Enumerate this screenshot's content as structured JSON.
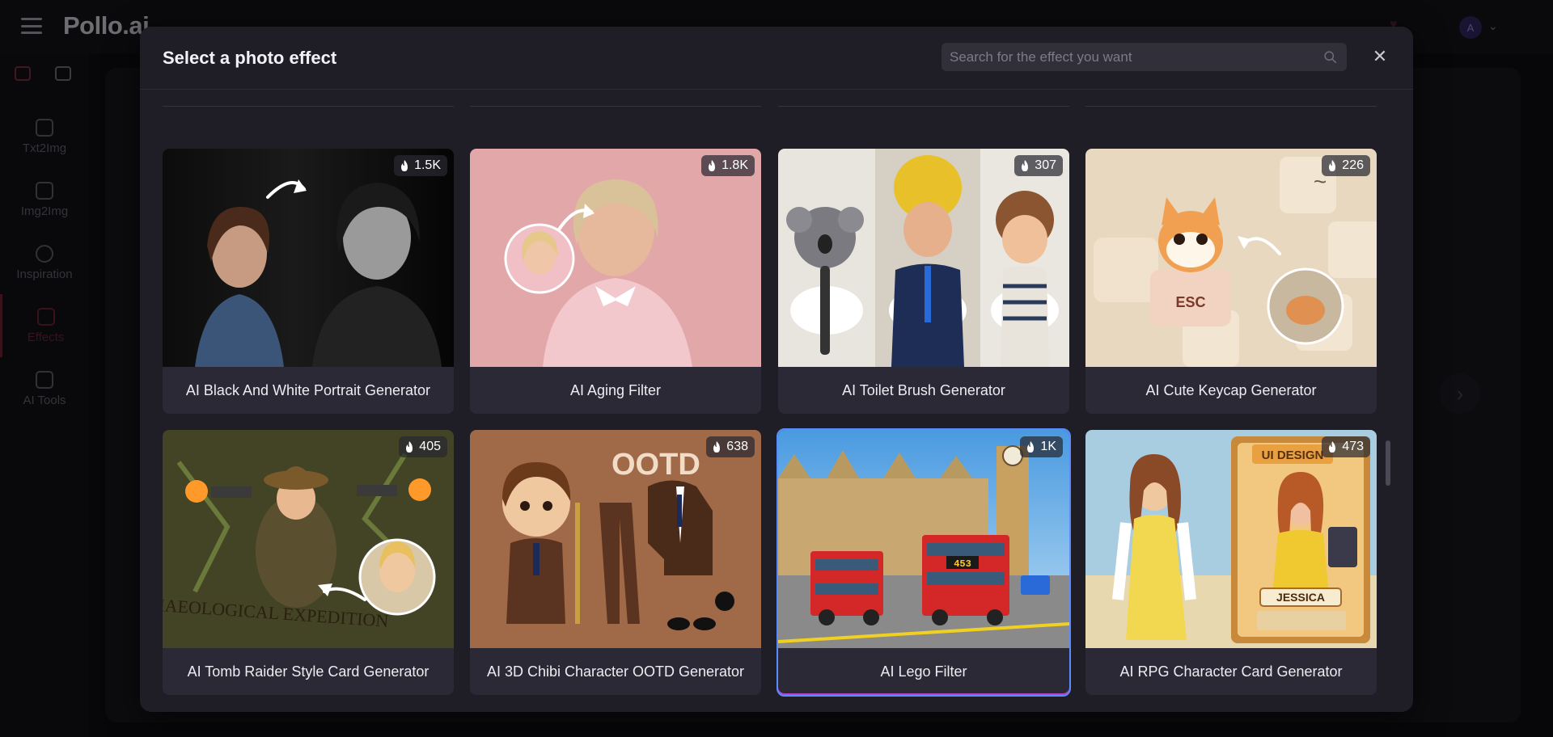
{
  "app": {
    "logo": "Pollo.ai",
    "avatar_initial": "A"
  },
  "sidebar": {
    "items": [
      {
        "label": "Txt2Img"
      },
      {
        "label": "Img2Img"
      },
      {
        "label": "Inspiration"
      },
      {
        "label": "Effects"
      },
      {
        "label": "AI Tools"
      }
    ]
  },
  "modal": {
    "title": "Select a photo effect",
    "search_placeholder": "Search for the effect you want",
    "close_glyph": "✕"
  },
  "effects": [
    {
      "label": "AI Black And White Portrait Generator",
      "count": "1.5K"
    },
    {
      "label": "AI Aging Filter",
      "count": "1.8K"
    },
    {
      "label": "AI Toilet Brush Generator",
      "count": "307"
    },
    {
      "label": "AI Cute Keycap Generator",
      "count": "226"
    },
    {
      "label": "AI Tomb Raider Style Card Generator",
      "count": "405"
    },
    {
      "label": "AI 3D Chibi Character OOTD Generator",
      "count": "638"
    },
    {
      "label": "AI Lego Filter",
      "count": "1K"
    },
    {
      "label": "AI RPG Character Card Generator",
      "count": "473"
    }
  ],
  "thumb_text": {
    "ootd": "OOTD",
    "keycap": "ESC",
    "bus": "453",
    "ui_design": "UI DESIGN",
    "jessica": "JESSICA",
    "expedition": "ARCHAEOLOGICAL EXPEDITION"
  },
  "colors": {
    "modal_bg": "#1f1e27",
    "card_bg": "#2a2935",
    "selected_border": "#5a8cff"
  }
}
